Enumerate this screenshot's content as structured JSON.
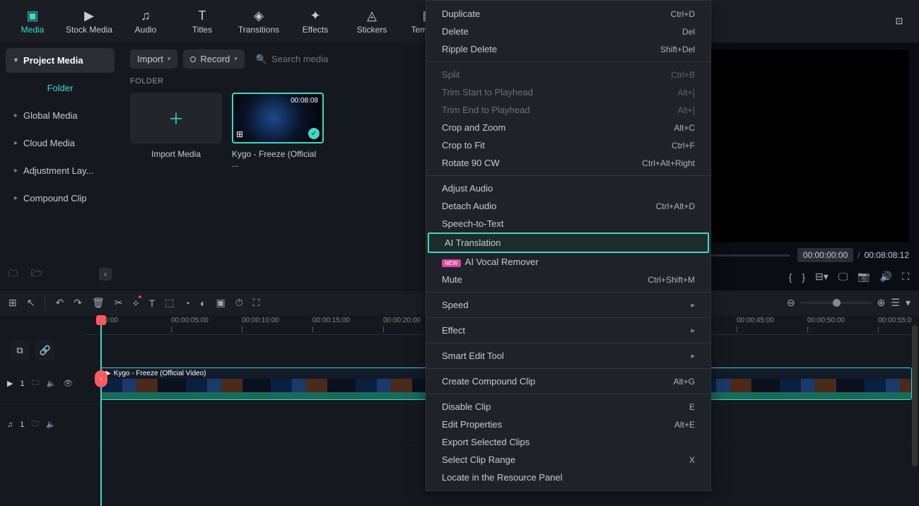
{
  "toolbar": {
    "items": [
      {
        "label": "Media",
        "icon": "▢"
      },
      {
        "label": "Stock Media",
        "icon": "▶"
      },
      {
        "label": "Audio",
        "icon": "♫"
      },
      {
        "label": "Titles",
        "icon": "T"
      },
      {
        "label": "Transitions",
        "icon": "◈"
      },
      {
        "label": "Effects",
        "icon": "✦"
      },
      {
        "label": "Stickers",
        "icon": "◬"
      },
      {
        "label": "Template",
        "icon": "▦"
      }
    ]
  },
  "sidebar": {
    "items": [
      {
        "label": "Project Media"
      },
      {
        "label": "Folder"
      },
      {
        "label": "Global Media"
      },
      {
        "label": "Cloud Media"
      },
      {
        "label": "Adjustment Lay..."
      },
      {
        "label": "Compound Clip"
      }
    ]
  },
  "content": {
    "import_label": "Import",
    "record_label": "Record",
    "search_placeholder": "Search media",
    "section_title": "FOLDER",
    "import_card_label": "Import Media",
    "clip_duration": "00:08:08",
    "clip_label": "Kygo - Freeze (Official ..."
  },
  "preview": {
    "current_time": "00:00:00:00",
    "total_time": "00:08:08:12"
  },
  "timeline": {
    "ticks": [
      "00:00",
      "00:00:05:00",
      "00:00:10:00",
      "00:00:15:00",
      "00:00:20:00",
      "00:00:45:00",
      "00:00:50:00",
      "00:00:55:0"
    ],
    "clip_title": "Kygo - Freeze (Official Video)",
    "track1_num": "1",
    "track2_num": "1"
  },
  "ctx": {
    "items": [
      {
        "label": "Duplicate",
        "shortcut": "Ctrl+D"
      },
      {
        "label": "Delete",
        "shortcut": "Del"
      },
      {
        "label": "Ripple Delete",
        "shortcut": "Shift+Del"
      },
      {
        "sep": true
      },
      {
        "label": "Split",
        "shortcut": "Ctrl+B",
        "disabled": true
      },
      {
        "label": "Trim Start to Playhead",
        "shortcut": "Alt+[",
        "disabled": true
      },
      {
        "label": "Trim End to Playhead",
        "shortcut": "Alt+]",
        "disabled": true
      },
      {
        "label": "Crop and Zoom",
        "shortcut": "Alt+C"
      },
      {
        "label": "Crop to Fit",
        "shortcut": "Ctrl+F"
      },
      {
        "label": "Rotate 90 CW",
        "shortcut": "Ctrl+Alt+Right"
      },
      {
        "sep": true
      },
      {
        "label": "Adjust Audio"
      },
      {
        "label": "Detach Audio",
        "shortcut": "Ctrl+Alt+D"
      },
      {
        "label": "Speech-to-Text"
      },
      {
        "label": "AI Translation",
        "highlighted": true
      },
      {
        "label": "AI Vocal Remover",
        "badge": "NEW"
      },
      {
        "label": "Mute",
        "shortcut": "Ctrl+Shift+M"
      },
      {
        "sep": true
      },
      {
        "label": "Speed",
        "submenu": true
      },
      {
        "sep": true
      },
      {
        "label": "Effect",
        "submenu": true
      },
      {
        "sep": true
      },
      {
        "label": "Smart Edit Tool",
        "submenu": true
      },
      {
        "sep": true
      },
      {
        "label": "Create Compound Clip",
        "shortcut": "Alt+G"
      },
      {
        "sep": true
      },
      {
        "label": "Disable Clip",
        "shortcut": "E"
      },
      {
        "label": "Edit Properties",
        "shortcut": "Alt+E"
      },
      {
        "label": "Export Selected Clips"
      },
      {
        "label": "Select Clip Range",
        "shortcut": "X"
      },
      {
        "label": "Locate in the Resource Panel"
      }
    ]
  }
}
